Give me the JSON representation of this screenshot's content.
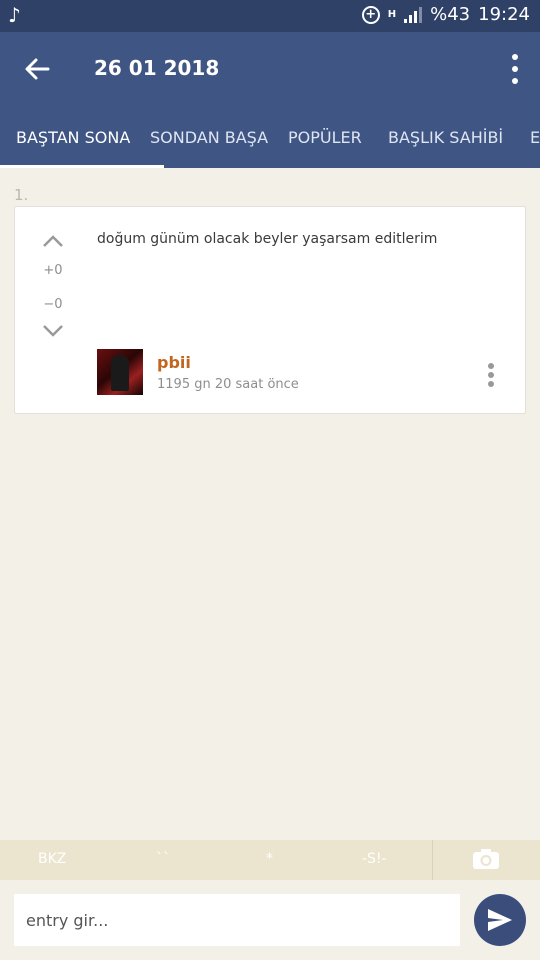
{
  "status_bar": {
    "network": "H",
    "battery": "%43",
    "time": "19:24"
  },
  "app_bar": {
    "title": "26 01 2018"
  },
  "tabs": [
    {
      "label": "BAŞTAN SONA"
    },
    {
      "label": "SONDAN BAŞA"
    },
    {
      "label": "POPÜLER"
    },
    {
      "label": "BAŞLIK SAHİBİ"
    },
    {
      "label": "E"
    }
  ],
  "entry": {
    "number": "1.",
    "text": "doğum günüm olacak beyler yaşarsam editlerim",
    "score_plus": "+0",
    "score_minus": "−0",
    "author": "pbii",
    "time_ago": "1195 gn 20 saat  önce"
  },
  "toolbar": {
    "bkz": "BKZ",
    "backticks": "``",
    "asterisk": "*",
    "spoiler": "-S!-"
  },
  "input": {
    "placeholder": "entry gir..."
  },
  "colors": {
    "status_bar": "#2f4167",
    "app_bar": "#3f5584",
    "background": "#f3f1e7",
    "author": "#c2651f",
    "send_button": "#3a4d7b"
  }
}
